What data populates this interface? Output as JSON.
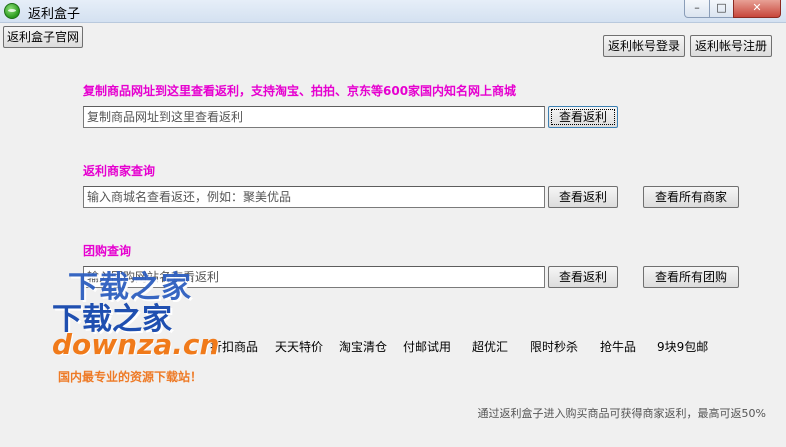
{
  "window": {
    "title": "返利盒子",
    "controls": {
      "minimize": "–",
      "maximize": "□",
      "close": "✕"
    }
  },
  "toolbar": {
    "official_site": "返利盒子官网",
    "login": "返利帐号登录",
    "register": "返利帐号注册"
  },
  "sections": {
    "product": {
      "label": "复制商品网址到这里查看返利，支持淘宝、拍拍、京东等600家国内知名网上商城",
      "placeholder": "复制商品网址到这里查看返利",
      "check_button": "查看返利"
    },
    "merchant": {
      "label": "返利商家查询",
      "placeholder": "输入商城名查看返还，例如：聚美优品",
      "check_button": "查看返利",
      "all_button": "查看所有商家"
    },
    "groupbuy": {
      "label": "团购查询",
      "placeholder": "输入团购网站名查看返利",
      "check_button": "查看返利",
      "all_button": "查看所有团购"
    }
  },
  "nav_links": [
    "折扣商品",
    "天天特价",
    "淘宝清仓",
    "付邮试用",
    "超优汇",
    "限时秒杀",
    "抢牛品",
    "9块9包邮"
  ],
  "footer_note": "通过返利盒子进入购买商品可获得商家返利，最高可返50%",
  "watermark": {
    "line1": "下载之家",
    "line2": "下载之家",
    "domain": "downza.cn",
    "tagline": "国内最专业的资源下载站！"
  },
  "colors": {
    "accent_label": "#e600d0",
    "watermark_blue": "#1f4fb0",
    "watermark_orange": "#f07a1a"
  }
}
